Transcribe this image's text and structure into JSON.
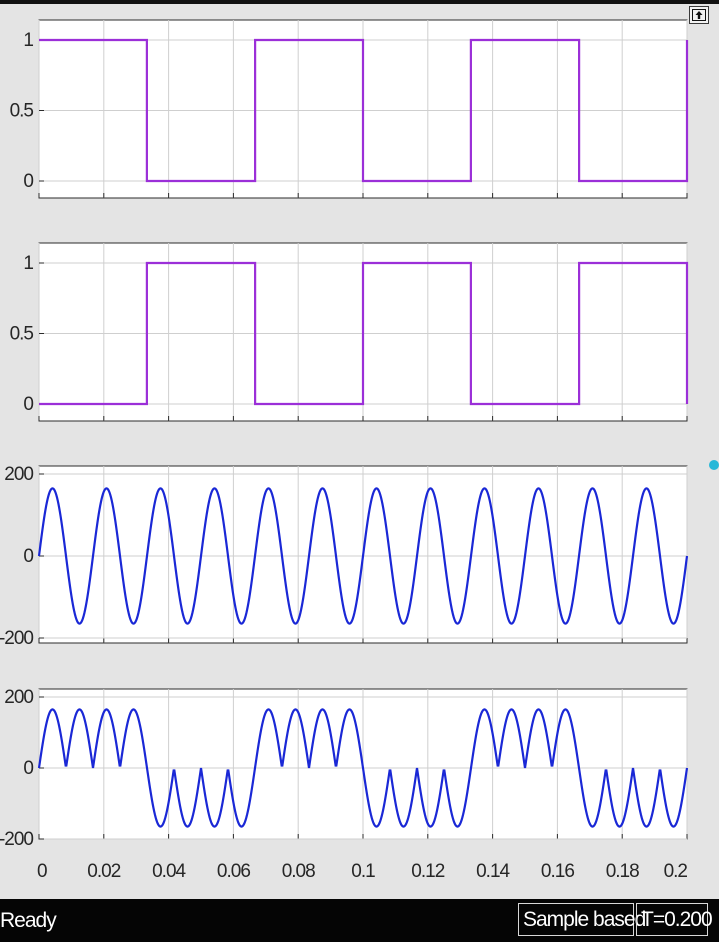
{
  "status": {
    "text": "Ready",
    "sample_mode": "Sample based",
    "time": "T=0.200"
  },
  "colors": {
    "gate": "#9b2fd8",
    "sine": "#1a28d6",
    "accent_dot": "#28b8d8"
  },
  "icons": {
    "undock": "undock-arrow-icon"
  },
  "x_axis": {
    "ticks": [
      "0",
      "0.02",
      "0.04",
      "0.06",
      "0.08",
      "0.1",
      "0.12",
      "0.14",
      "0.16",
      "0.18",
      "0.2"
    ],
    "range": [
      0,
      0.2
    ]
  },
  "chart_data": [
    {
      "type": "line",
      "xlim": [
        0,
        0.2
      ],
      "ylim": [
        -0.1,
        1.1
      ],
      "yticks": [
        "1",
        "0.5",
        "0"
      ],
      "series": [
        {
          "x": [
            0,
            0.0333,
            0.0333,
            0.0667,
            0.0667,
            0.1,
            0.1,
            0.1333,
            0.1333,
            0.1667,
            0.1667,
            0.2,
            0.2
          ],
          "values": [
            1,
            1,
            0,
            0,
            1,
            1,
            0,
            0,
            1,
            1,
            0,
            0,
            1
          ]
        }
      ]
    },
    {
      "type": "line",
      "xlim": [
        0,
        0.2
      ],
      "ylim": [
        -0.1,
        1.1
      ],
      "yticks": [
        "1",
        "0.5",
        "0"
      ],
      "series": [
        {
          "x": [
            0,
            0.0333,
            0.0333,
            0.0667,
            0.0667,
            0.1,
            0.1,
            0.1333,
            0.1333,
            0.1667,
            0.1667,
            0.2,
            0.2
          ],
          "values": [
            0,
            0,
            1,
            1,
            0,
            0,
            1,
            1,
            0,
            0,
            1,
            1,
            0
          ]
        }
      ]
    },
    {
      "type": "line",
      "xlim": [
        0,
        0.2
      ],
      "ylim": [
        -200,
        200
      ],
      "yticks": [
        "200",
        "0",
        "-200"
      ],
      "series": [
        {
          "function": "sine",
          "amplitude": 165,
          "frequency_hz": 60
        }
      ]
    },
    {
      "type": "line",
      "xlim": [
        0,
        0.2
      ],
      "ylim": [
        -200,
        200
      ],
      "yticks": [
        "200",
        "0",
        "-200"
      ],
      "series": [
        {
          "function": "gated-rectified-sine",
          "amplitude": 165,
          "frequency_hz": 60,
          "gate_period_s": 0.0667
        }
      ]
    }
  ]
}
